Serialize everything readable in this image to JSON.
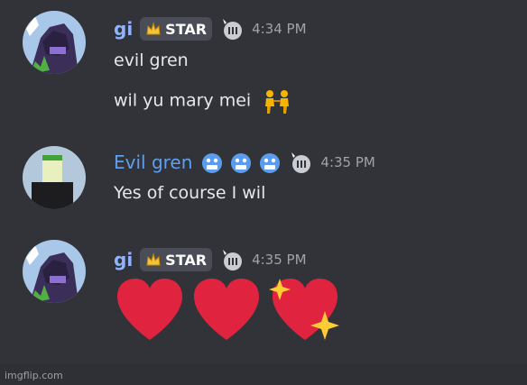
{
  "messages": [
    {
      "username": "gi",
      "tag": "STAR",
      "time": "4:34 PM",
      "lines": [
        "evil gren",
        "wil yu mary mei"
      ]
    },
    {
      "username": "Evil gren",
      "time": "4:35 PM",
      "lines": [
        "Yes of course I wil"
      ]
    },
    {
      "username": "gi",
      "tag": "STAR",
      "time": "4:35 PM",
      "emojis": [
        "red-heart",
        "red-heart",
        "sparkling-heart"
      ]
    }
  ],
  "watermark": "imgflip.com",
  "colors": {
    "background": "#313338",
    "username_gi": "#8fb3ff",
    "username_evil": "#5f9ff0",
    "timestamp": "#9ea3ab",
    "heart": "#e0233f"
  }
}
